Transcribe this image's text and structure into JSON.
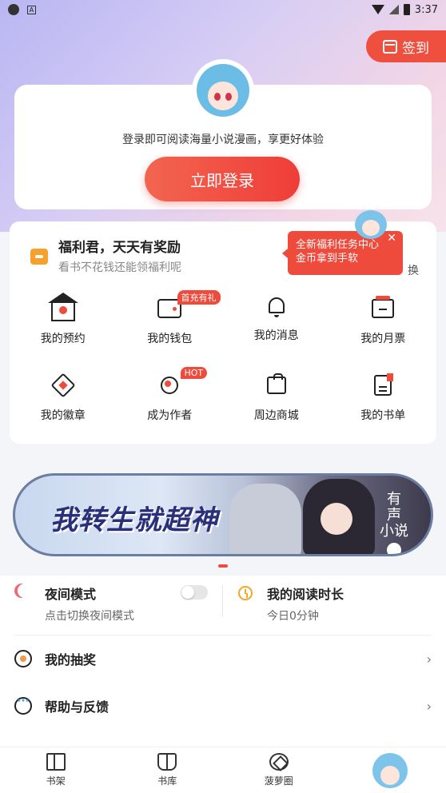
{
  "status_bar": {
    "time": "3:37",
    "badge_letter": "A"
  },
  "signin": {
    "label": "签到"
  },
  "login": {
    "tip": "登录即可阅读海量小说漫画，享更好体验",
    "button": "立即登录"
  },
  "welfare": {
    "title": "福利君，天天有奖励",
    "subtitle": "看书不花钱还能领福利呢",
    "more_partial": "换",
    "bubble_line1": "全新福利任务中心",
    "bubble_line2": "金币拿到手软",
    "bubble_close": "✕"
  },
  "grid": [
    {
      "label": "我的预约",
      "icon": "house-icon",
      "tag": ""
    },
    {
      "label": "我的钱包",
      "icon": "wallet-icon",
      "tag": "首充有礼"
    },
    {
      "label": "我的消息",
      "icon": "bell-icon",
      "tag": ""
    },
    {
      "label": "我的月票",
      "icon": "ticket-icon",
      "tag": ""
    },
    {
      "label": "我的徽章",
      "icon": "badge-icon",
      "tag": ""
    },
    {
      "label": "成为作者",
      "icon": "author-icon",
      "tag": "HOT"
    },
    {
      "label": "周边商城",
      "icon": "shopping-bag-icon",
      "tag": ""
    },
    {
      "label": "我的书单",
      "icon": "booklist-icon",
      "tag": ""
    }
  ],
  "banner": {
    "title": "我转生就超神",
    "audio_line1": "有",
    "audio_line2": "声",
    "audio_line3": "小说"
  },
  "settings": {
    "night_title": "夜间模式",
    "night_sub": "点击切换夜间模式",
    "night_enabled": false,
    "read_title": "我的阅读时长",
    "read_sub": "今日0分钟",
    "lottery": "我的抽奖",
    "help": "帮助与反馈",
    "chevron": "›"
  },
  "tabbar": [
    {
      "label": "书架",
      "icon": "bookshelf-icon"
    },
    {
      "label": "书库",
      "icon": "library-icon"
    },
    {
      "label": "菠萝圈",
      "icon": "circle-icon"
    },
    {
      "label": "",
      "icon": "avatar"
    }
  ],
  "colors": {
    "accent": "#ef4b3d",
    "warning": "#f5a623",
    "info": "#3f9be8"
  }
}
